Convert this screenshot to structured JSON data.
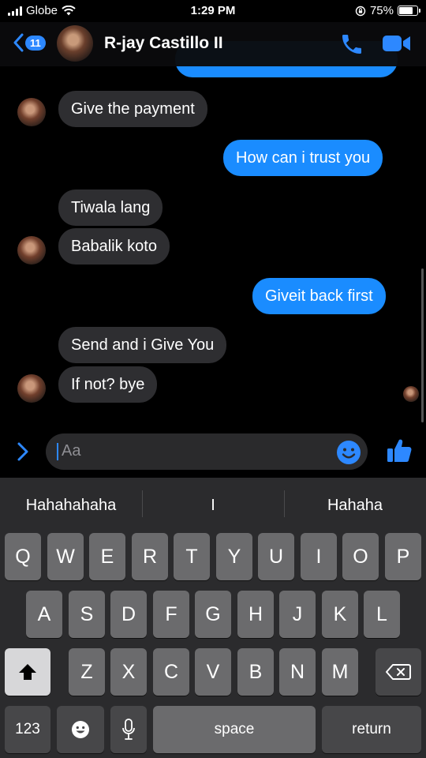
{
  "status_bar": {
    "carrier": "Globe",
    "time": "1:29 PM",
    "battery_percent": "75%",
    "battery_level": 0.75
  },
  "header": {
    "back_badge": "11",
    "contact_name": "R-jay Castillo II"
  },
  "messages": [
    {
      "text": "Give the payment",
      "from": "them"
    },
    {
      "text": "How can i trust you",
      "from": "me"
    },
    {
      "text": "Tiwala lang",
      "from": "them"
    },
    {
      "text": "Babalik koto",
      "from": "them"
    },
    {
      "text": "Giveit back first",
      "from": "me"
    },
    {
      "text": "Send and i Give You",
      "from": "them"
    },
    {
      "text": "If not? bye",
      "from": "them"
    }
  ],
  "composer": {
    "text": "Aa"
  },
  "keyboard": {
    "suggestions": [
      "Hahahahaha",
      "I",
      "Hahaha"
    ],
    "row1": [
      "Q",
      "W",
      "E",
      "R",
      "T",
      "Y",
      "U",
      "I",
      "O",
      "P"
    ],
    "row2": [
      "A",
      "S",
      "D",
      "F",
      "G",
      "H",
      "J",
      "K",
      "L"
    ],
    "row3": [
      "Z",
      "X",
      "C",
      "V",
      "B",
      "N",
      "M"
    ],
    "numbers_label": "123",
    "space_label": "space",
    "return_label": "return"
  },
  "colors": {
    "accent": "#1a8cff",
    "incoming_bubble": "#2e2e31",
    "background": "#000000"
  }
}
